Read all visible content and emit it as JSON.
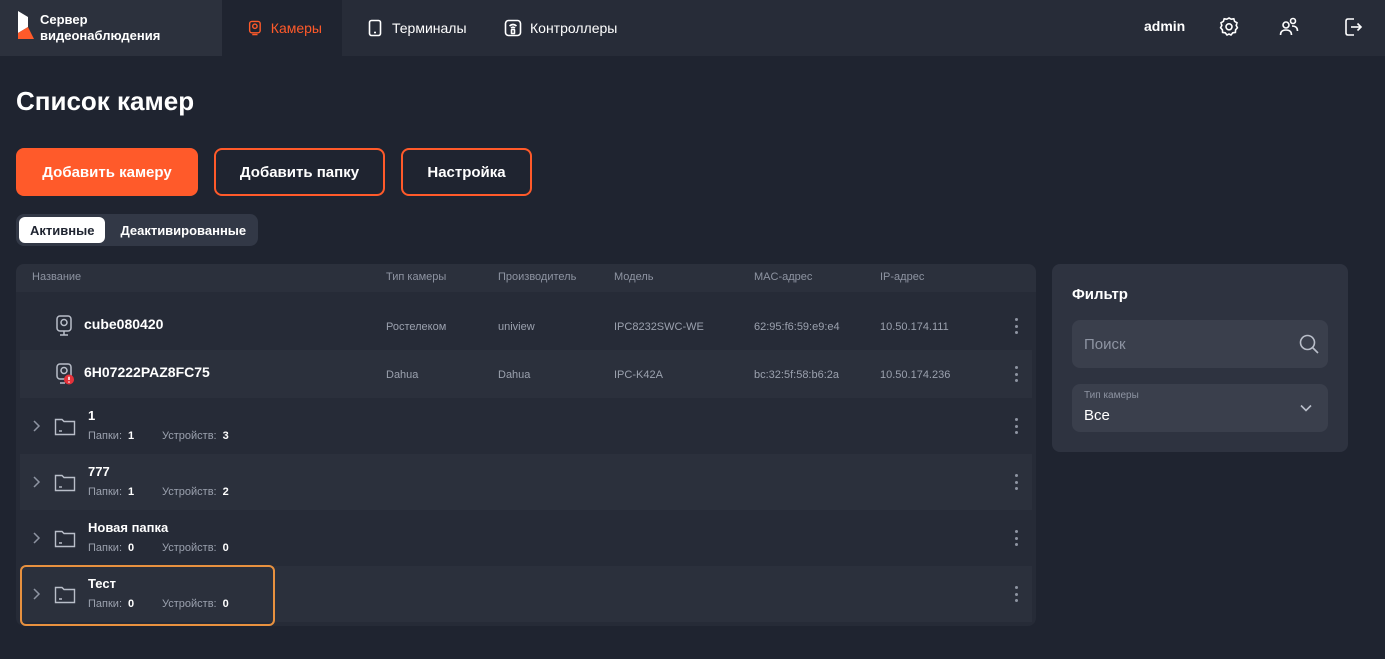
{
  "brand": {
    "line1": "Сервер",
    "line2": "видеонаблюдения"
  },
  "nav": {
    "cameras": "Камеры",
    "terminals": "Терминалы",
    "controllers": "Контроллеры"
  },
  "user": {
    "name": "admin"
  },
  "page": {
    "title": "Список камер"
  },
  "actions": {
    "add_camera": "Добавить камеру",
    "add_folder": "Добавить папку",
    "settings": "Настройка"
  },
  "segments": {
    "active": "Активные",
    "deactivated": "Деактивированные"
  },
  "table": {
    "headers": {
      "name": "Название",
      "type": "Тип камеры",
      "vendor": "Производитель",
      "model": "Модель",
      "mac": "MAC-адрес",
      "ip": "IP-адрес"
    },
    "cameras": [
      {
        "name": "cube080420",
        "type": "Ростелеком",
        "vendor": "uniview",
        "model": "IPC8232SWC-WE",
        "mac": "62:95:f6:59:e9:e4",
        "ip": "10.50.174.111"
      },
      {
        "name": "6H07222PAZ8FC75",
        "type": "Dahua",
        "vendor": "Dahua",
        "model": "IPC-K42A",
        "mac": "bc:32:5f:58:b6:2a",
        "ip": "10.50.174.236"
      }
    ],
    "folder_labels": {
      "folders": "Папки:",
      "devices": "Устройств:"
    },
    "folders": [
      {
        "name": "1",
        "folders": "1",
        "devices": "3"
      },
      {
        "name": "777",
        "folders": "1",
        "devices": "2"
      },
      {
        "name": "Новая папка",
        "folders": "0",
        "devices": "0"
      },
      {
        "name": "Тест",
        "folders": "0",
        "devices": "0"
      }
    ]
  },
  "filter": {
    "title": "Фильтр",
    "search_placeholder": "Поиск",
    "camera_type_label": "Тип камеры",
    "camera_type_value": "Все"
  },
  "colors": {
    "accent": "#ff5a2a",
    "background": "#1f2430",
    "error_badge": "#e5323a",
    "highlight": "#e8913f"
  }
}
